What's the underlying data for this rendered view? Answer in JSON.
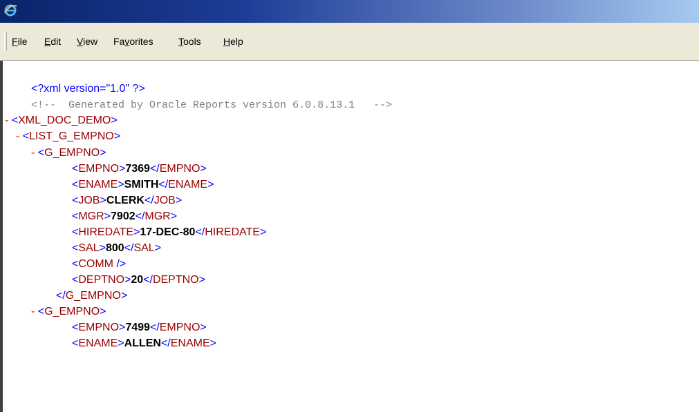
{
  "menu": [
    "File",
    "Edit",
    "View",
    "Favorites",
    "Tools",
    "Help"
  ],
  "menu_mnemonic_index": [
    0,
    0,
    0,
    2,
    0,
    0
  ],
  "xml": {
    "pi": "<?xml version=\"1.0\" ?>",
    "comment": "<!--  Generated by Oracle Reports version 6.0.8.13.1   -->",
    "toggle": "-",
    "root": "XML_DOC_DEMO",
    "list": "LIST_G_EMPNO",
    "group": "G_EMPNO",
    "rec1": {
      "EMPNO": "7369",
      "ENAME": "SMITH",
      "JOB": "CLERK",
      "MGR": "7902",
      "HIREDATE": "17-DEC-80",
      "SAL": "800",
      "COMM": "",
      "DEPTNO": "20"
    },
    "rec2": {
      "EMPNO": "7499",
      "ENAME": "ALLEN"
    },
    "empty_tag": "COMM"
  },
  "colors": {
    "tag": "#990000",
    "bracket": "#0000ff",
    "comment": "#808080",
    "toggle": "#ff0000"
  }
}
